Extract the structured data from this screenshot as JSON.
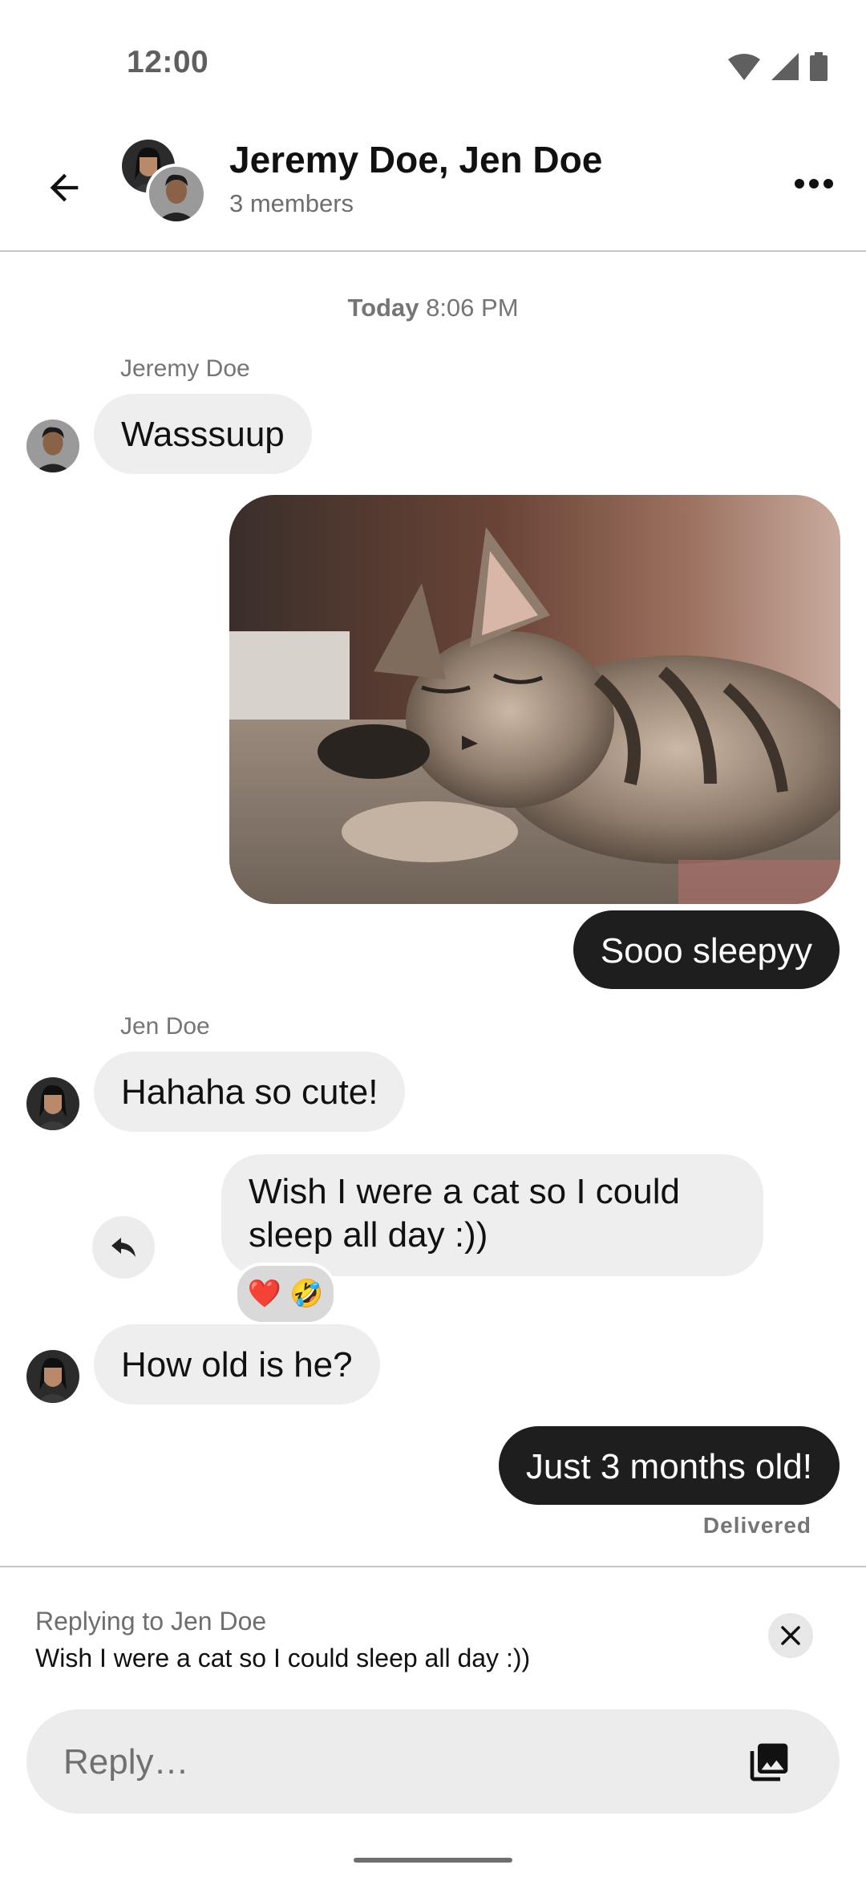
{
  "status_bar": {
    "time": "12:00",
    "icons": [
      "wifi-icon",
      "signal-icon",
      "battery-icon"
    ]
  },
  "header": {
    "back_icon": "arrow-left-icon",
    "title": "Jeremy Doe, Jen Doe",
    "subtitle": "3 members",
    "more_icon": "more-horizontal-icon"
  },
  "chat": {
    "date_label_day": "Today",
    "date_label_time": "8:06 PM",
    "messages": [
      {
        "sender": "Jeremy Doe",
        "text": "Wasssuup",
        "direction": "in"
      },
      {
        "type": "image",
        "description_icon": "cat-photo",
        "direction": "out"
      },
      {
        "text": "Sooo sleepyy",
        "direction": "out"
      },
      {
        "sender": "Jen Doe",
        "text": "Hahaha so cute!",
        "direction": "in"
      },
      {
        "text_line1": "Wish I were a cat so I could",
        "text_line2": "sleep all day :))",
        "direction": "in",
        "reactions": [
          "❤️",
          "🤣"
        ]
      },
      {
        "text": "How old is he?",
        "direction": "in"
      },
      {
        "text": "Just 3 months old!",
        "direction": "out",
        "status": "Delivered"
      }
    ]
  },
  "composer": {
    "reply_label": "Replying to Jen Doe",
    "reply_text": "Wish I were a cat so I could sleep all day :))",
    "input_placeholder": "Reply…",
    "close_icon": "close-icon",
    "gallery_icon": "gallery-icon"
  },
  "colors": {
    "incoming_bubble": "#eeeeee",
    "outgoing_bubble": "#1e1e1e",
    "meta_text": "#757575"
  }
}
